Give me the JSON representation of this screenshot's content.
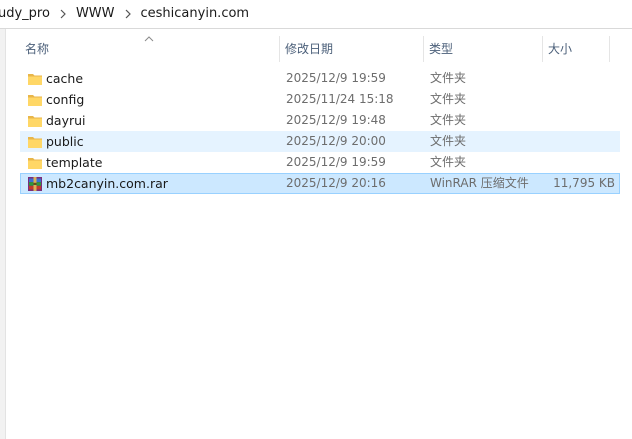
{
  "breadcrumb": {
    "items": [
      "udy_pro",
      "WWW",
      "ceshicanyin.com"
    ]
  },
  "columns": {
    "name": "名称",
    "date": "修改日期",
    "type": "类型",
    "size": "大小"
  },
  "files": [
    {
      "name": "cache",
      "date": "2025/12/9 19:59",
      "type": "文件夹",
      "size": "",
      "icon": "folder-icon",
      "state": "normal"
    },
    {
      "name": "config",
      "date": "2025/11/24 15:18",
      "type": "文件夹",
      "size": "",
      "icon": "folder-icon",
      "state": "normal"
    },
    {
      "name": "dayrui",
      "date": "2025/12/9 19:48",
      "type": "文件夹",
      "size": "",
      "icon": "folder-icon",
      "state": "normal"
    },
    {
      "name": "public",
      "date": "2025/12/9 20:00",
      "type": "文件夹",
      "size": "",
      "icon": "folder-icon",
      "state": "hover"
    },
    {
      "name": "template",
      "date": "2025/12/9 19:59",
      "type": "文件夹",
      "size": "",
      "icon": "folder-icon",
      "state": "normal"
    },
    {
      "name": "mb2canyin.com.rar",
      "date": "2025/12/9 20:16",
      "type": "WinRAR 压缩文件",
      "size": "11,795 KB",
      "icon": "winrar-archive-icon",
      "state": "selected"
    }
  ],
  "colors": {
    "hover_bg": "#e5f3ff",
    "selected_bg": "#cce8ff",
    "selected_border": "#99d1ff",
    "folder_yellow": "#ffd766",
    "header_text": "#4c607a"
  }
}
